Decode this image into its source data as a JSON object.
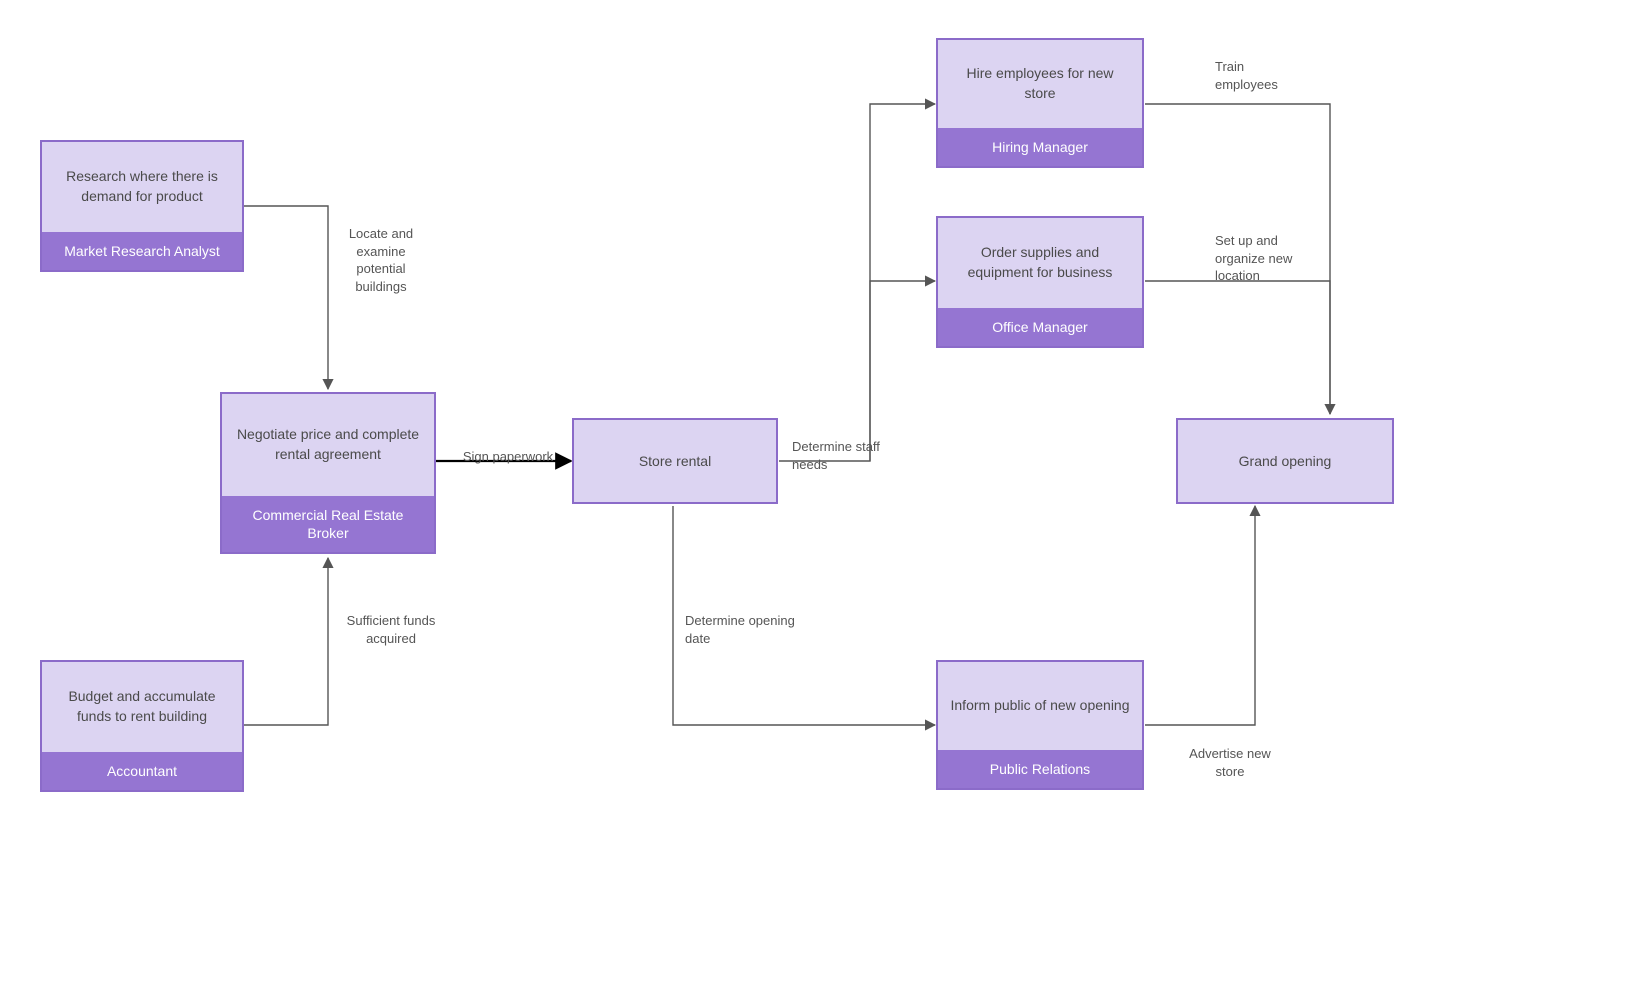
{
  "nodes": {
    "marketResearch": {
      "task": "Research where there is demand for product",
      "role": "Market Research Analyst"
    },
    "accountant": {
      "task": "Budget and accumulate funds to rent building",
      "role": "Accountant"
    },
    "broker": {
      "task": "Negotiate price and complete rental agreement",
      "role": "Commercial Real Estate Broker"
    },
    "storeRental": {
      "label": "Store rental"
    },
    "hiring": {
      "task": "Hire employees for new store",
      "role": "Hiring Manager"
    },
    "office": {
      "task": "Order supplies and equipment for business",
      "role": "Office Manager"
    },
    "pr": {
      "task": "Inform public of new opening",
      "role": "Public Relations"
    },
    "grand": {
      "label": "Grand opening"
    }
  },
  "edges": {
    "locate": "Locate and examine potential buildings",
    "funds": "Sufficient funds acquired",
    "sign": "Sign paperwork",
    "staff": "Determine staff needs",
    "date": "Determine opening date",
    "train": "Train employees",
    "setup": "Set up and organize new location",
    "advert": "Advertise new store"
  }
}
